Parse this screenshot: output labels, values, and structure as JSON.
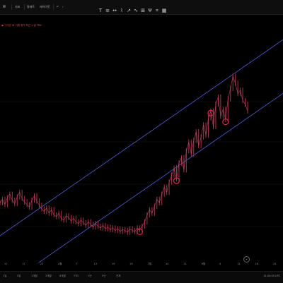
{
  "toolbar": {
    "timeframe_label": "지표",
    "indicators_label": "팔레트",
    "templates_label": "레이아웃",
    "undo_icon": "undo-icon",
    "redo_icon": "redo-icon"
  },
  "drawing_tools": [
    "T",
    "≡",
    "↔",
    "⌇",
    "↗",
    "∿",
    "⊞",
    "Ψ",
    "⌗",
    "▦"
  ],
  "legend": {
    "name": "● 거래량 ₩",
    "values": "거래 종가 최근 1 일 차트"
  },
  "time_axis": {
    "ticks": [
      "11",
      "17",
      "23",
      "4월",
      "7",
      "13",
      "19",
      "25",
      "7월",
      "14",
      "21",
      "8월",
      "4",
      "11",
      "18",
      "25"
    ]
  },
  "bottom_bar": {
    "ranges": [
      "1일",
      "5일",
      "1개월",
      "3개월",
      "6개월",
      "YTD",
      "1년",
      "5년",
      "전체"
    ],
    "clock": "11:24:05 UTC"
  },
  "colors": {
    "candle": "#a8324a",
    "channel": "#4a5ecf",
    "marker": "#e0294a",
    "grid": "#1a1a1a"
  },
  "chart_data": {
    "type": "line",
    "title": "",
    "series": [
      {
        "values": [
          100,
          104,
          98,
          106,
          110,
          103,
          99,
          107,
          112,
          105,
          101,
          98,
          95,
          103,
          108,
          102,
          97,
          93,
          90,
          94,
          88,
          92,
          86,
          84,
          88,
          82,
          80,
          85,
          83,
          79,
          82,
          78,
          76,
          80,
          77,
          74,
          78,
          75,
          72,
          76,
          73,
          71,
          74,
          70,
          72,
          69,
          71,
          68,
          70,
          67,
          69,
          68,
          66,
          70,
          68,
          67,
          71,
          69,
          73,
          78,
          86,
          92,
          88,
          96,
          104,
          100,
          110,
          118,
          112,
          124,
          132,
          140,
          128,
          146,
          152,
          138,
          160,
          170,
          156,
          172,
          182,
          166,
          176,
          190,
          178,
          198,
          206,
          188,
          214,
          222,
          200,
          208,
          196,
          220,
          232,
          246,
          238,
          226,
          230,
          218,
          214,
          206
        ]
      }
    ],
    "channel": {
      "upper": [
        [
          0,
          62
        ],
        [
          100,
          260
        ]
      ],
      "lower": [
        [
          0,
          0
        ],
        [
          100,
          198
        ]
      ]
    },
    "touch_points": [
      57,
      72,
      86,
      92
    ]
  }
}
